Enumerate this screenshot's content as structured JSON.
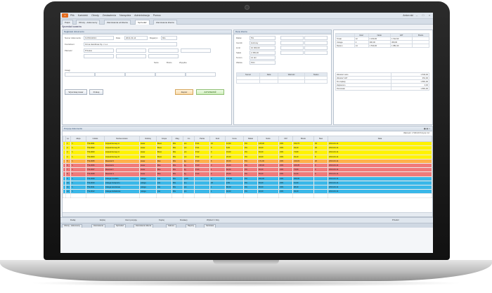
{
  "window": {
    "title": "Artimata Invent – Opiekun / Magazyn",
    "user": "Anton ski",
    "app_icon": "A",
    "menu": [
      "Plik",
      "Kartoteki",
      "Obroty",
      "Zestawienia",
      "Narzędzia",
      "Administracja",
      "Pomoc"
    ],
    "controls": {
      "minimize": "–",
      "maximize": "□",
      "close": "×"
    }
  },
  "tabs": [
    {
      "label": "Pulpit"
    },
    {
      "label": "Obroty - dokumenty"
    },
    {
      "label": "Zamówienia od klienta"
    },
    {
      "label": "Sprzedaż"
    },
    {
      "label": "Zamówienie klienta"
    }
  ],
  "subtitle": "Sprzedaż towarów",
  "header_panel": {
    "title": "Nagłówek dokumentu",
    "number_label": "Numer dokumentu",
    "number_value": "FV/001/2013",
    "date_label": "Data",
    "date_value": "2013-03-14",
    "client_label": "Kontrahent",
    "client_value": "Firma Handlowa Sp. z o.o.",
    "warehouse_label": "Magazyn",
    "warehouse_value": "MG",
    "payment_label": "Płatność",
    "payment_value": "Przelew",
    "checkbox_labels": [
      "Netto",
      "Brutto",
      "Wysyłka"
    ],
    "notes_label": "Uwagi",
    "buttons": {
      "search": "Wyszukaj towar",
      "print": "Drukuj",
      "save_draft": "Zapisz",
      "accept": "ZATWIERDŹ"
    }
  },
  "client_panel": {
    "title": "Dane klienta",
    "rows": [
      {
        "label": "Rabat",
        "value": "5%"
      },
      {
        "label": "Cennik",
        "value": "Hurtowy"
      },
      {
        "label": "Limit",
        "value": "10 000,00"
      },
      {
        "label": "Saldo",
        "value": "2 450,00"
      },
      {
        "label": "Termin",
        "value": "14 dni"
      },
      {
        "label": "Waluta",
        "value": "PLN"
      }
    ],
    "table_headers": [
      "Numer",
      "Data",
      "Wartość",
      "Status"
    ]
  },
  "summary_panel": {
    "headers": [
      "Ilość",
      "Netto",
      "VAT",
      "Brutto"
    ],
    "rows": [
      [
        "Towar",
        "12",
        "1 230,00",
        "1 512,90"
      ],
      [
        "Usługa",
        "2",
        "300,00",
        "369,00"
      ],
      [
        "Razem",
        "14",
        "1 530,00",
        "1 881,90"
      ]
    ],
    "totals": [
      {
        "label": "Wartość netto",
        "value": "1 530,00"
      },
      {
        "label": "Wartość VAT",
        "value": "351,90"
      },
      {
        "label": "Do zapłaty",
        "value": "1 881,90"
      },
      {
        "label": "Zapłacono",
        "value": "0,00"
      },
      {
        "label": "Pozostało",
        "value": "1 881,90"
      }
    ]
  },
  "grid": {
    "title": "Pozycje dokumentu",
    "summary": "Wartość: 1 530,00  Pozycji: 12",
    "columns": [
      "",
      "Lp.",
      "Akcje",
      "Indeks",
      "Nazwa towaru",
      "Rodzaj",
      "Grupa",
      "Mag.",
      "Jm",
      "Partia",
      "Ilość",
      "Cena",
      "Rabat",
      "Netto",
      "VAT",
      "Brutto",
      "Stan",
      "Data"
    ],
    "rows": [
      {
        "color": "yellow",
        "cells": [
          "",
          "1",
          "✎",
          "TW-0001",
          "Artykuł biurowy A",
          "towar",
          "Biuro",
          "MG",
          "szt.",
          "P-01",
          "10",
          "12,50",
          "0%",
          "125,00",
          "23%",
          "153,75",
          "45",
          "2013-03-14"
        ]
      },
      {
        "color": "yellow",
        "cells": [
          "",
          "2",
          "✎",
          "TW-0002",
          "Artykuł biurowy B",
          "towar",
          "Biuro",
          "MG",
          "szt.",
          "P-01",
          "5",
          "8,00",
          "0%",
          "40,00",
          "23%",
          "49,20",
          "30",
          "2013-03-14"
        ]
      },
      {
        "color": "yellow",
        "cells": [
          "",
          "3",
          "✎",
          "TW-0003",
          "Artykuł biurowy C",
          "towar",
          "Biuro",
          "MG",
          "szt.",
          "P-02",
          "4",
          "15,00",
          "0%",
          "60,00",
          "23%",
          "73,80",
          "12",
          "2013-03-14"
        ]
      },
      {
        "color": "yellow",
        "cells": [
          "",
          "4",
          "✎",
          "TW-0004",
          "Artykuł biurowy D",
          "towar",
          "Biuro",
          "MG",
          "szt.",
          "P-02",
          "2",
          "20,00",
          "0%",
          "40,00",
          "23%",
          "49,20",
          "8",
          "2013-03-14"
        ]
      },
      {
        "color": "orange",
        "cells": [
          "",
          "5",
          "✎",
          "TW-0005",
          "Materiał D",
          "towar",
          "Mat.",
          "MG",
          "kg",
          "P-03",
          "6",
          "30,00",
          "5%",
          "171,00",
          "23%",
          "210,33",
          "20",
          "2013-03-14"
        ]
      },
      {
        "color": "red",
        "cells": [
          "",
          "6",
          "✎",
          "TW-0006",
          "Materiał E",
          "towar",
          "Mat.",
          "MG",
          "kg",
          "P-03",
          "3",
          "45,00",
          "0%",
          "135,00",
          "23%",
          "166,05",
          "0",
          "2013-03-14"
        ]
      },
      {
        "color": "red",
        "cells": [
          "",
          "7",
          "✎",
          "TW-0007",
          "Materiał F",
          "towar",
          "Mat.",
          "MG",
          "kg",
          "P-04",
          "1",
          "60,00",
          "0%",
          "60,00",
          "23%",
          "73,80",
          "0",
          "2013-03-14"
        ]
      },
      {
        "color": "red",
        "cells": [
          "",
          "8",
          "✎",
          "TW-0008",
          "Materiał G",
          "towar",
          "Mat.",
          "MG",
          "kg",
          "P-04",
          "2",
          "25,00",
          "0%",
          "50,00",
          "23%",
          "61,50",
          "0",
          "2013-03-14"
        ]
      },
      {
        "color": "blue",
        "cells": [
          "",
          "9",
          "✎",
          "TW-0009",
          "Usługa montażu",
          "usługa",
          "Usł.",
          "MG",
          "godz.",
          "",
          "2",
          "150,00",
          "0%",
          "300,00",
          "23%",
          "369,00",
          "",
          "2013-03-14"
        ]
      },
      {
        "color": "blue",
        "cells": [
          "",
          "10",
          "✎",
          "TW-0010",
          "Usługa transportu",
          "usługa",
          "Usł.",
          "MG",
          "km",
          "",
          "20",
          "2,50",
          "0%",
          "50,00",
          "23%",
          "61,50",
          "",
          "2013-03-14"
        ]
      },
      {
        "color": "blue",
        "cells": [
          "",
          "11",
          "✎",
          "TW-0011",
          "Usługa serwisowa",
          "usługa",
          "Usł.",
          "MG",
          "szt.",
          "",
          "1",
          "80,00",
          "0%",
          "80,00",
          "23%",
          "98,40",
          "",
          "2013-03-14"
        ]
      },
      {
        "color": "blue",
        "cells": [
          "",
          "12",
          "✎",
          "TW-0012",
          "Usługa dodatkowa",
          "usługa",
          "Usł.",
          "MG",
          "szt.",
          "",
          "1",
          "40,00",
          "0%",
          "40,00",
          "23%",
          "49,20",
          "",
          "2013-03-14"
        ]
      },
      {
        "color": "empty",
        "cells": [
          "",
          "",
          "",
          "",
          "",
          "",
          "",
          "",
          "",
          "",
          "",
          "",
          "",
          "",
          "",
          "",
          "",
          ""
        ]
      }
    ]
  },
  "bottom_buttons": [
    "Dodaj",
    "Edytuj",
    "Usuń pozycję",
    "Kopiuj",
    "Dostawy",
    "Wybierz z listy",
    "Przelicz"
  ],
  "status_tabs": [
    "Obroty - dokumenty",
    "Zamówienia",
    "Sprzedaż",
    "Zamówienie klienta",
    "Faktura",
    "Raporty",
    "Kartoteka"
  ],
  "colors": {
    "yellow": "#fff200",
    "orange": "#ffb04a",
    "red": "#f07a7a",
    "blue": "#3ab7e8",
    "accent": "#e36b1e"
  }
}
